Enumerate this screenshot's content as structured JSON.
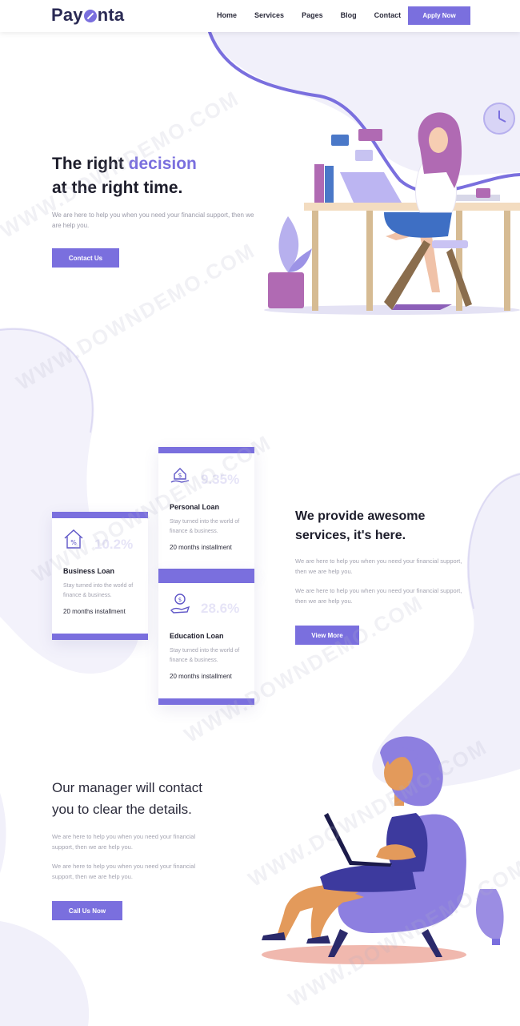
{
  "header": {
    "logo": {
      "prefix": "Pay",
      "suffix": "nta"
    },
    "nav": [
      {
        "label": "Home"
      },
      {
        "label": "Services"
      },
      {
        "label": "Pages"
      },
      {
        "label": "Blog"
      },
      {
        "label": "Contact"
      }
    ],
    "apply_label": "Apply Now"
  },
  "hero": {
    "title_part1": "The right ",
    "title_accent": "decision",
    "title_line2": "at the right time.",
    "text": "We are here to help you when you need your financial support, then we are help you.",
    "button_label": "Contact Us"
  },
  "loans": [
    {
      "name": "Personal Loan",
      "rate": "9.35%",
      "desc": "Stay turned into the world of finance & business.",
      "installment": "20 months installment",
      "icon": "hand-dollar-icon"
    },
    {
      "name": "Business Loan",
      "rate": "10.2%",
      "desc": "Stay turned into the world of finance & business.",
      "installment": "20 months installment",
      "icon": "house-percent-icon"
    },
    {
      "name": "Education Loan",
      "rate": "28.6%",
      "desc": "Stay turned into the world of finance & business.",
      "installment": "20 months installment",
      "icon": "coin-hand-icon"
    }
  ],
  "services": {
    "title_line1": "We provide awesome",
    "title_line2": "services, it's here.",
    "para1": "We are here to help you when you need your financial support, then we are help you.",
    "para2": "We are here to help you when you need your financial support, then we are help you.",
    "button_label": "View More"
  },
  "manager": {
    "title_line1": "Our manager will contact",
    "title_line2": "you to clear the details.",
    "para1": "We are here to help you when you need your financial support, then we are help you.",
    "para2": "We are here to help you when you need your financial support, then we are help you.",
    "button_label": "Call Us Now"
  },
  "watermark": "WWW.DOWNDEMO.COM",
  "colors": {
    "accent": "#7a6fde",
    "blob": "#f1f0fa",
    "dark": "#1d1d2b"
  }
}
